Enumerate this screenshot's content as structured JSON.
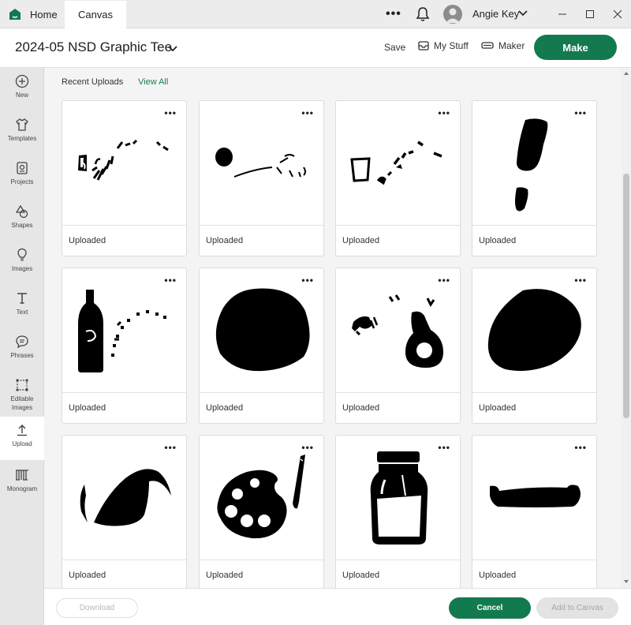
{
  "colors": {
    "accent": "#137a4f",
    "link": "#1b7a4e"
  },
  "titlebar": {
    "tabs": [
      {
        "label": "Home",
        "icon": "home-icon"
      },
      {
        "label": "Canvas"
      }
    ],
    "more_label": "•••",
    "user_name": "Angie Key"
  },
  "header": {
    "project_title": "2024-05 NSD Graphic Tee",
    "save_label": "Save",
    "mystuff_label": "My Stuff",
    "maker_label": "Maker",
    "make_label": "Make"
  },
  "sidebar": {
    "items": [
      {
        "label": "New",
        "icon": "plus-circle-icon"
      },
      {
        "label": "Templates",
        "icon": "shirt-icon"
      },
      {
        "label": "Projects",
        "icon": "projects-icon"
      },
      {
        "label": "Shapes",
        "icon": "shapes-icon"
      },
      {
        "label": "Images",
        "icon": "lightbulb-icon"
      },
      {
        "label": "Text",
        "icon": "text-icon"
      },
      {
        "label": "Phrases",
        "icon": "speech-bubble-icon"
      },
      {
        "label": "Editable Images",
        "icon": "editable-images-icon"
      },
      {
        "label": "Upload",
        "icon": "upload-icon",
        "active": true
      },
      {
        "label": "Monogram",
        "icon": "monogram-icon"
      }
    ]
  },
  "content": {
    "section_title": "Recent Uploads",
    "view_all_label": "View All",
    "card_menu": "•••",
    "cards": [
      {
        "label": "Uploaded",
        "art": "scattered-glyphs"
      },
      {
        "label": "Uploaded",
        "art": "dot-and-dashes"
      },
      {
        "label": "Uploaded",
        "art": "cup-and-dashes"
      },
      {
        "label": "Uploaded",
        "art": "exclamation-mark"
      },
      {
        "label": "Uploaded",
        "art": "bottle-with-dots"
      },
      {
        "label": "Uploaded",
        "art": "blob"
      },
      {
        "label": "Uploaded",
        "art": "avocado-with-hairdryer"
      },
      {
        "label": "Uploaded",
        "art": "blob"
      },
      {
        "label": "Uploaded",
        "art": "wave-swoosh"
      },
      {
        "label": "Uploaded",
        "art": "paint-palette"
      },
      {
        "label": "Uploaded",
        "art": "milk-jar"
      },
      {
        "label": "Uploaded",
        "art": "hotdog-bun"
      }
    ]
  },
  "footer": {
    "download_label": "Download",
    "cancel_label": "Cancel",
    "add_label": "Add to Canvas"
  }
}
